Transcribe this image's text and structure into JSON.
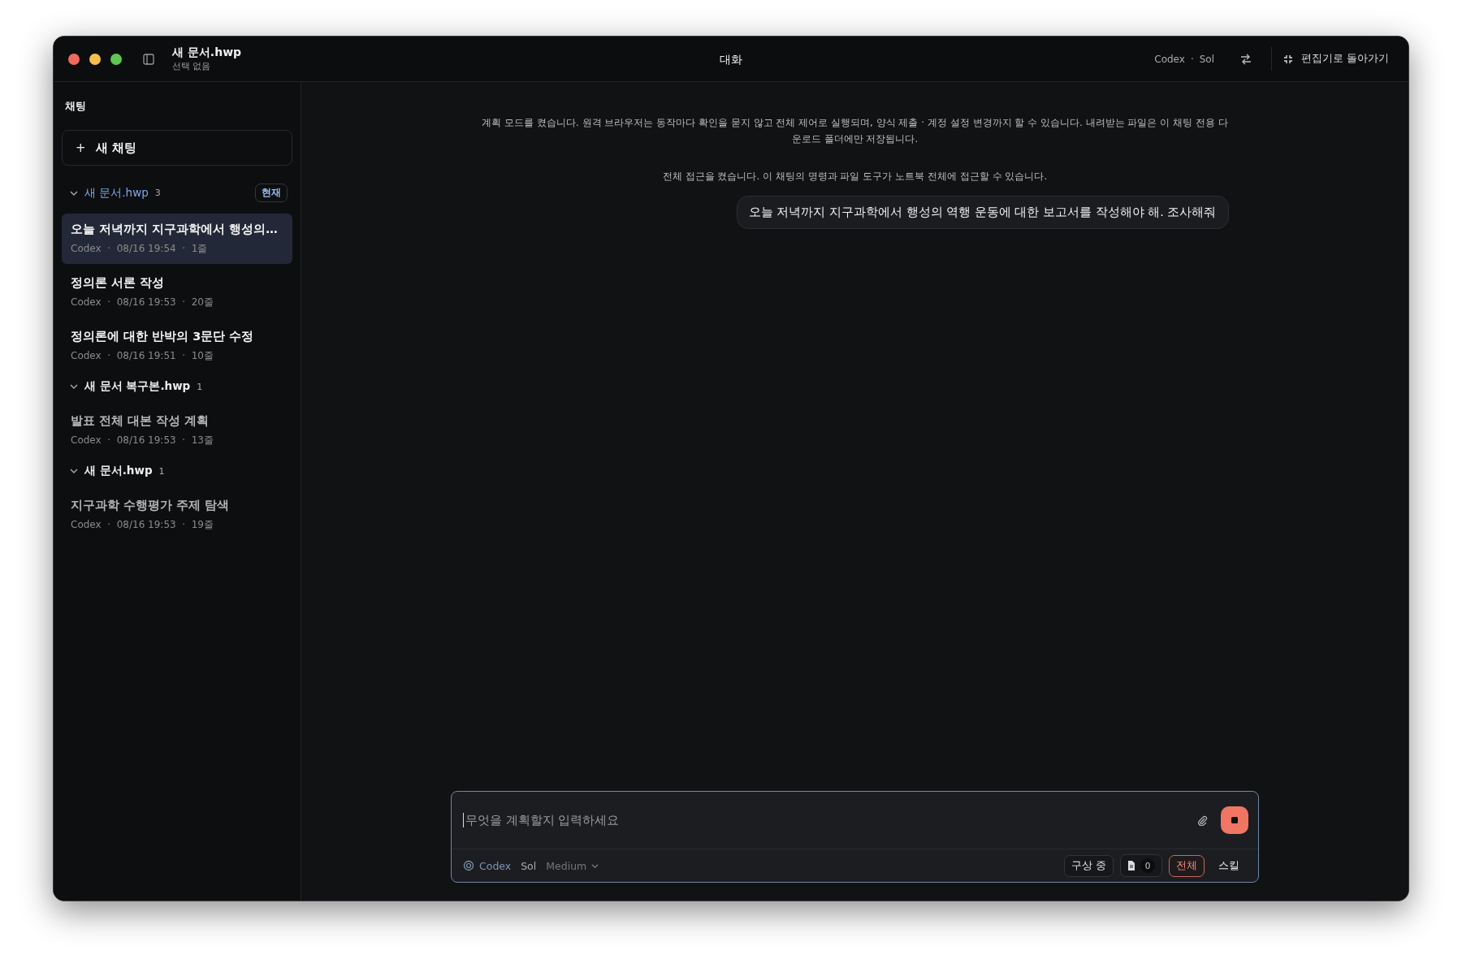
{
  "window": {
    "title": "새 문서.hwp",
    "subtitle": "선택 없음",
    "center_title": "대화",
    "model_label": "Codex",
    "model_sep": "·",
    "model_name": "Sol",
    "back_button": "편집기로 돌아가기"
  },
  "sidebar": {
    "heading": "채팅",
    "new_chat": "새 채팅",
    "new_chat_icon": "+",
    "groups": [
      {
        "name": "새 문서.hwp",
        "count": "3",
        "current": true,
        "badge": "현재",
        "expanded": true,
        "items": [
          {
            "title": "오늘 저녁까지 지구과학에서 행성의…",
            "meta": "Codex  ·  08/16 19:54  ·  1줄",
            "selected": true
          },
          {
            "title": "정의론 서론 작성",
            "meta": "Codex  ·  08/16 19:53  ·  20줄",
            "selected": false
          },
          {
            "title": "정의론에 대한 반박의 3문단 수정",
            "meta": "Codex  ·  08/16 19:51  ·  10줄",
            "selected": false
          }
        ]
      },
      {
        "name": "새 문서 복구본.hwp",
        "count": "1",
        "current": false,
        "expanded": true,
        "items": [
          {
            "title": "발표 전체 대본 작성 계획",
            "meta": "Codex  ·  08/16 19:53  ·  13줄",
            "selected": false
          }
        ]
      },
      {
        "name": "새 문서.hwp",
        "count": "1",
        "current": false,
        "expanded": true,
        "items": [
          {
            "title": "지구과학 수행평가 주제 탐색",
            "meta": "Codex  ·  08/16 19:53  ·  19줄",
            "selected": false
          }
        ]
      }
    ]
  },
  "messages": [
    {
      "kind": "system",
      "text": "계획 모드를 켰습니다. 원격 브라우저는 동작마다 확인을 묻지 않고 전체 제어로 실행되며, 양식 제출 · 계정 설정 변경까지 할 수 있습니다. 내려받는 파일은 이 채팅 전용 다운로드 폴더에만 저장됩니다."
    },
    {
      "kind": "system",
      "text": "전체 접근을 켰습니다. 이 채팅의 명령과 파일 도구가 노트북 전체에 접근할 수 있습니다."
    },
    {
      "kind": "user",
      "text": "오늘 저녁까지 지구과학에서 행성의 역행 운동에 대한 보고서를 작성해야 해. 조사해줘"
    }
  ],
  "composer": {
    "placeholder": "무엇을 계획할지 입력하세요",
    "provider": "Codex",
    "model": "Sol",
    "effort": "Medium",
    "chips": [
      {
        "kind": "status",
        "label": "구상 중",
        "selected": false
      },
      {
        "kind": "files",
        "label": "0",
        "selected": false
      },
      {
        "kind": "toggle",
        "label": "전체",
        "selected": true
      },
      {
        "kind": "plain",
        "label": "스킬",
        "selected": false
      }
    ]
  }
}
